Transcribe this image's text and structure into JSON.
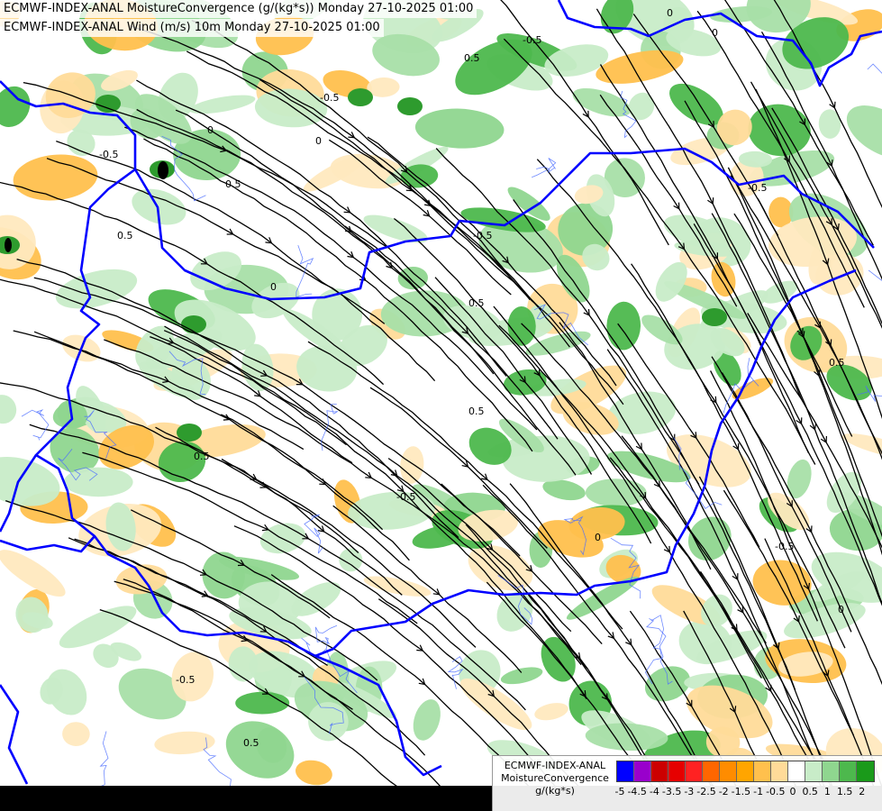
{
  "header": {
    "line1": "ECMWF-INDEX-ANAL MoistureConvergence (g/(kg*s)) Monday 27-10-2025 01:00",
    "line2": "ECMWF-INDEX-ANAL Wind (m/s) 10m Monday 27-10-2025 01:00"
  },
  "legend": {
    "source": "ECMWF-INDEX-ANAL",
    "parameter": "MoistureConvergence",
    "unit": "g/(kg*s)",
    "levels": [
      "-5",
      "-4.5",
      "-4",
      "-3.5",
      "-3",
      "-2.5",
      "-2",
      "-1.5",
      "-1",
      "-0.5",
      "0",
      "0.5",
      "1",
      "1.5",
      "2"
    ],
    "colors": [
      "#0000ff",
      "#9900cc",
      "#cc0000",
      "#e60000",
      "#ff2222",
      "#ff6600",
      "#ff8c00",
      "#ffa500",
      "#ffc04d",
      "#ffdb99",
      "#ffffff",
      "#c8ecc8",
      "#8fd68f",
      "#4db84d",
      "#1a9a1a"
    ]
  },
  "map": {
    "contour_labels": [
      "0.5",
      "0",
      "-0.5",
      "0.5",
      "-0.5",
      "0",
      "-0.5",
      "0.5",
      "0",
      "-0.5",
      "0.5",
      "-0.5",
      "0",
      "0.5",
      "-0.5",
      "0",
      "0.5",
      "-0.5",
      "0.5",
      "0",
      "-0.5",
      "0.5",
      "0"
    ],
    "border_color": "#0000ff",
    "river_color": "#4a6cff",
    "streamline_color": "#000000"
  }
}
